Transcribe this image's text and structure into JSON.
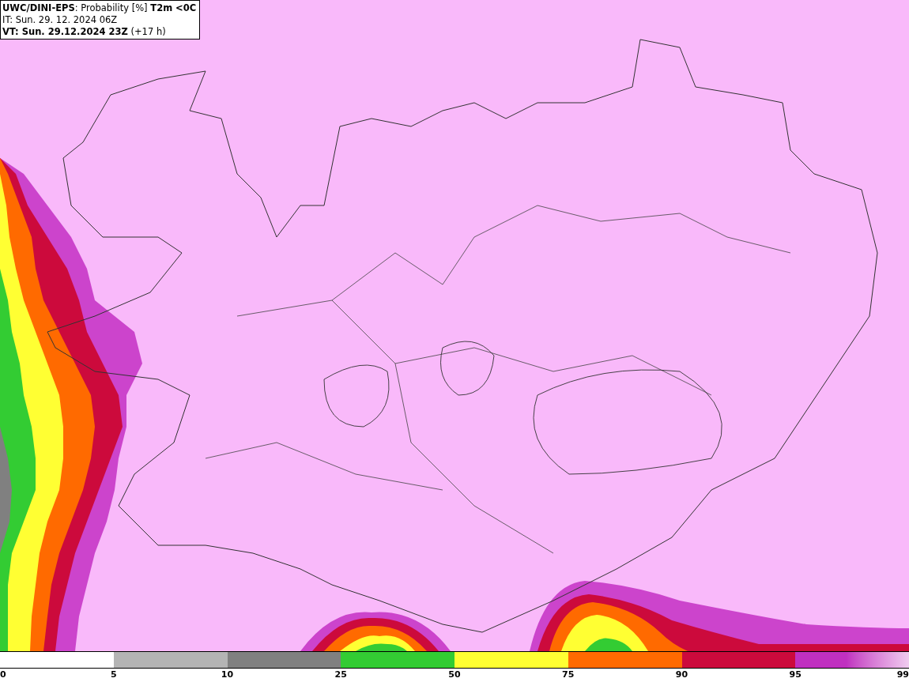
{
  "header": {
    "lines": [
      "**UWC/DINI-EPS**: Probability [%] **T2m <0C**",
      "IT: Sun. 29. 12. 2024 06Z",
      "**VT: Sun. 29.12.2024 23Z** (+17 h)"
    ]
  },
  "legend": {
    "segments": [
      {
        "color": "#ffffff"
      },
      {
        "color": "#b4b4b4"
      },
      {
        "color": "#808080"
      },
      {
        "color": "#33cc33"
      },
      {
        "color": "#ffff33"
      },
      {
        "color": "#ff6a00"
      },
      {
        "color": "#cc0a3c"
      },
      {
        "color": "#c030c0",
        "kind": "fade"
      }
    ],
    "ticks": [
      "0",
      "5",
      "10",
      "25",
      "50",
      "75",
      "90",
      "95",
      "99"
    ]
  }
}
